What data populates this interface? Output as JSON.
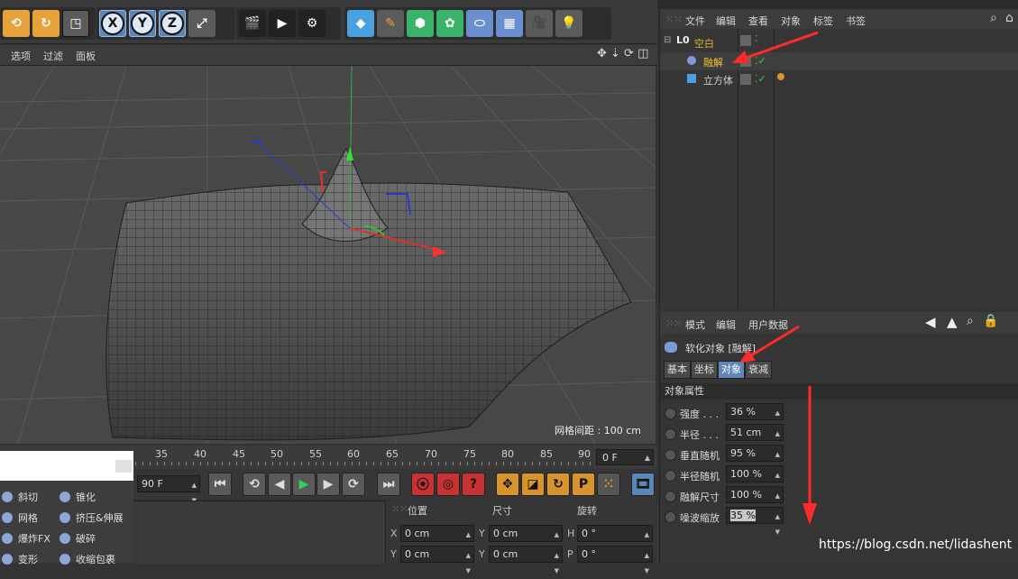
{
  "viewport_menu": {
    "options": "选项",
    "filter": "过滤",
    "panel": "面板"
  },
  "viewport": {
    "grid_spacing": "网格间距 : 100 cm"
  },
  "timeline": {
    "ticks": [
      "35",
      "40",
      "45",
      "50",
      "55",
      "60",
      "65",
      "70",
      "75",
      "80",
      "85",
      "90"
    ],
    "current_frame": "0 F",
    "end_frame": "90 F"
  },
  "palette": {
    "items": [
      {
        "label": "斜切",
        "icon": "bevel-icon"
      },
      {
        "label": "锥化",
        "icon": "taper-icon"
      },
      {
        "label": "网格",
        "icon": "mesh-icon"
      },
      {
        "label": "挤压&伸展",
        "icon": "squash-icon"
      },
      {
        "label": "爆炸FX",
        "icon": "explosion-icon"
      },
      {
        "label": "破碎",
        "icon": "shatter-icon"
      },
      {
        "label": "变形",
        "icon": "deform-icon"
      },
      {
        "label": "收缩包裹",
        "icon": "shrinkwrap-icon"
      }
    ]
  },
  "coords": {
    "headers": {
      "position": "位置",
      "size": "尺寸",
      "rotation": "旋转"
    },
    "rows": [
      {
        "axis": "X",
        "pos": "0 cm",
        "size_axis": "Y",
        "size": "0 cm",
        "rot_axis": "H",
        "rot": "0 °"
      },
      {
        "axis": "Y",
        "pos": "0 cm",
        "size_axis": "Y",
        "size": "0 cm",
        "rot_axis": "P",
        "rot": "0 °"
      }
    ]
  },
  "object_manager": {
    "menu": [
      "文件",
      "编辑",
      "查看",
      "对象",
      "标签",
      "书签"
    ],
    "objects": [
      {
        "name": "空白",
        "color": "#e0b030"
      },
      {
        "name": "融解",
        "color": "#f0c030"
      },
      {
        "name": "立方体",
        "color": "#cfcfcf"
      }
    ]
  },
  "attribute_manager": {
    "menu": [
      "模式",
      "编辑",
      "用户数据"
    ],
    "title": "软化对象 [融解]",
    "tabs": [
      "基本",
      "坐标",
      "对象",
      "衰减"
    ],
    "active_tab": "对象",
    "section": "对象属性",
    "props": [
      {
        "label": "强度 . . .",
        "value": "36 %"
      },
      {
        "label": "半径 . . .",
        "value": "51 cm"
      },
      {
        "label": "垂直随机",
        "value": "95 %"
      },
      {
        "label": "半径随机",
        "value": "100 %"
      },
      {
        "label": "融解尺寸",
        "value": "100 %"
      },
      {
        "label": "噪波缩放",
        "value": "35 %"
      }
    ]
  },
  "watermark": "https://blog.csdn.net/lidashent",
  "colors": {
    "accent": "#5b86b8",
    "arrow": "#ff2a2a"
  }
}
